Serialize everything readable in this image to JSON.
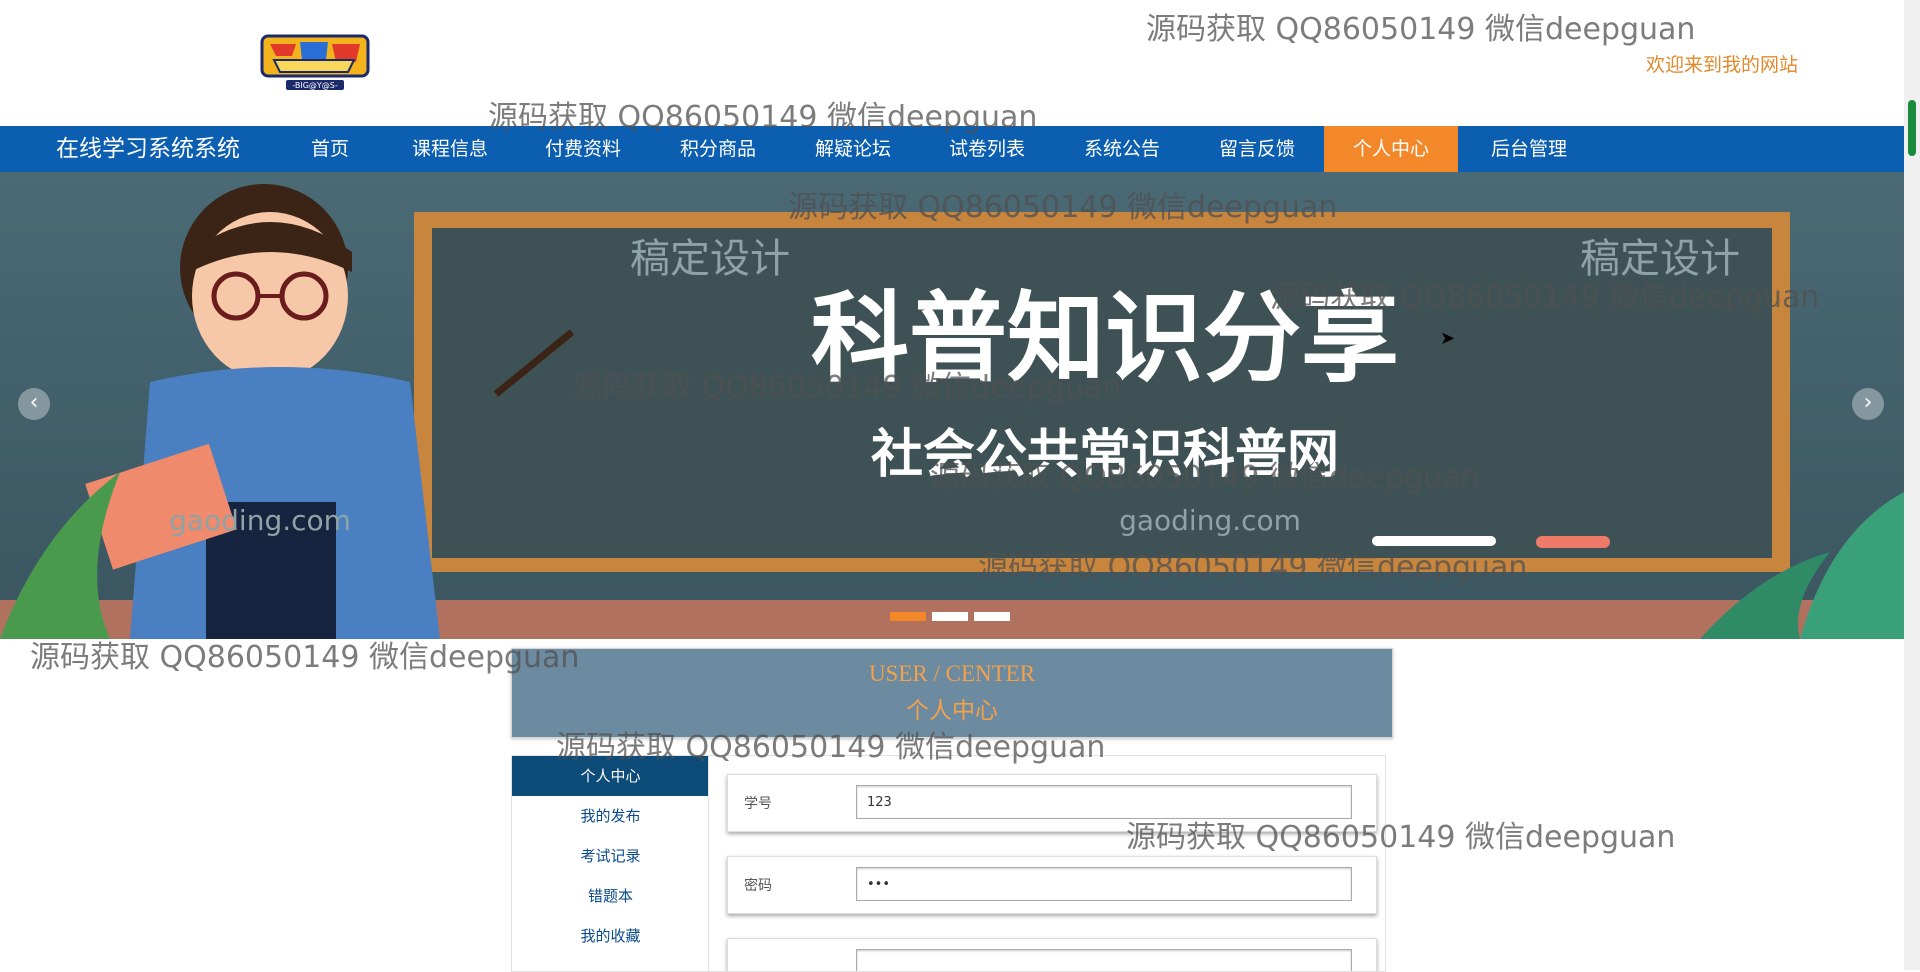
{
  "header": {
    "logo_alt": "Digimon Adventure logo",
    "welcome": "欢迎来到我的网站"
  },
  "nav": {
    "brand": "在线学习系统系统",
    "items": [
      {
        "label": "首页",
        "active": false
      },
      {
        "label": "课程信息",
        "active": false
      },
      {
        "label": "付费资料",
        "active": false
      },
      {
        "label": "积分商品",
        "active": false
      },
      {
        "label": "解疑论坛",
        "active": false
      },
      {
        "label": "试卷列表",
        "active": false
      },
      {
        "label": "系统公告",
        "active": false
      },
      {
        "label": "留言反馈",
        "active": false
      },
      {
        "label": "个人中心",
        "active": true
      },
      {
        "label": "后台管理",
        "active": false
      }
    ]
  },
  "banner": {
    "headline": "科普知识分享",
    "subline": "社会公共常识科普网",
    "tagline_left": "稿定设计",
    "tagline_right": "稿定设计",
    "domain_left": "gaoding.com",
    "domain_right": "gaoding.com",
    "prev_icon": "chevron-left-icon",
    "next_icon": "chevron-right-icon",
    "slide_count": 3,
    "active_slide": 1
  },
  "user_center": {
    "title_en": "USER / CENTER",
    "title_cn": "个人中心"
  },
  "sidebar": {
    "items": [
      {
        "label": "个人中心",
        "active": true
      },
      {
        "label": "我的发布",
        "active": false
      },
      {
        "label": "考试记录",
        "active": false
      },
      {
        "label": "错题本",
        "active": false
      },
      {
        "label": "我的收藏",
        "active": false
      }
    ]
  },
  "form": {
    "fields": [
      {
        "label": "学号",
        "value": "123"
      },
      {
        "label": "密码",
        "value": "•••"
      },
      {
        "label": "",
        "value": ""
      }
    ]
  },
  "watermark_text": "源码获取 QQ86050149 微信deepguan",
  "colors": {
    "nav_bg": "#0b5eb0",
    "accent": "#f3882a",
    "welcome": "#e08a2d",
    "user_center_bg": "#6c8aa0",
    "sidebar_active": "#0d4b78"
  }
}
